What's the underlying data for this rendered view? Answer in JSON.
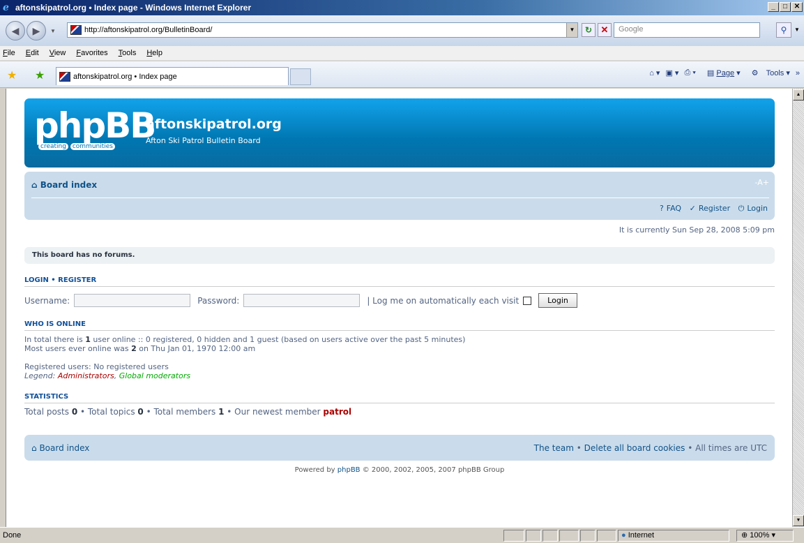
{
  "window": {
    "title": "aftonskipatrol.org • Index page - Windows Internet Explorer",
    "min": "_",
    "max": "□",
    "close": "✕"
  },
  "nav": {
    "url": "http://aftonskipatrol.org/BulletinBoard/",
    "search_placeholder": "Google"
  },
  "menu": [
    "File",
    "Edit",
    "View",
    "Favorites",
    "Tools",
    "Help"
  ],
  "tab": {
    "title": "aftonskipatrol.org • Index page"
  },
  "commands": {
    "page": "Page",
    "tools": "Tools"
  },
  "header": {
    "logo_word": "phpBB",
    "logo_tag_1": "creating",
    "logo_tag_2": "communities",
    "site_name": "aftonskipatrol.org",
    "site_desc": "Afton Ski Patrol Bulletin Board"
  },
  "navbar": {
    "board_index": "Board index",
    "font_size": "-A+",
    "faq": "FAQ",
    "register": "Register",
    "login": "Login"
  },
  "current_time": "It is currently Sun Sep 28, 2008 5:09 pm",
  "no_forums": "This board has no forums.",
  "login_section": {
    "heading": "LOGIN • REGISTER",
    "username_label": "Username:",
    "password_label": "Password:",
    "auto_login_label": "| Log me on automatically each visit",
    "login_button": "Login"
  },
  "online": {
    "heading": "WHO IS ONLINE",
    "line1_a": "In total there is ",
    "line1_count": "1",
    "line1_b": " user online :: 0 registered, 0 hidden and 1 guest (based on users active over the past 5 minutes)",
    "line2_a": "Most users ever online was ",
    "line2_count": "2",
    "line2_b": " on Thu Jan 01, 1970 12:00 am",
    "registered": "Registered users: No registered users",
    "legend_label": "Legend: ",
    "legend_admin": "Administrators",
    "legend_sep": ", ",
    "legend_gmod": "Global moderators"
  },
  "stats": {
    "heading": "STATISTICS",
    "posts_label": "Total posts ",
    "posts": "0",
    "topics_label": " • Total topics ",
    "topics": "0",
    "members_label": " • Total members ",
    "members": "1",
    "newest_label": " • Our newest member ",
    "newest": "patrol"
  },
  "footer": {
    "board_index": "Board index",
    "team": "The team",
    "sep": " • ",
    "delete_cookies": "Delete all board cookies",
    "utc": " • All times are UTC",
    "powered_a": "Powered by ",
    "powered_link": "phpBB",
    "powered_b": " © 2000, 2002, 2005, 2007 phpBB Group"
  },
  "status": {
    "text": "Done",
    "zone": "Internet",
    "zoom": "100%"
  }
}
